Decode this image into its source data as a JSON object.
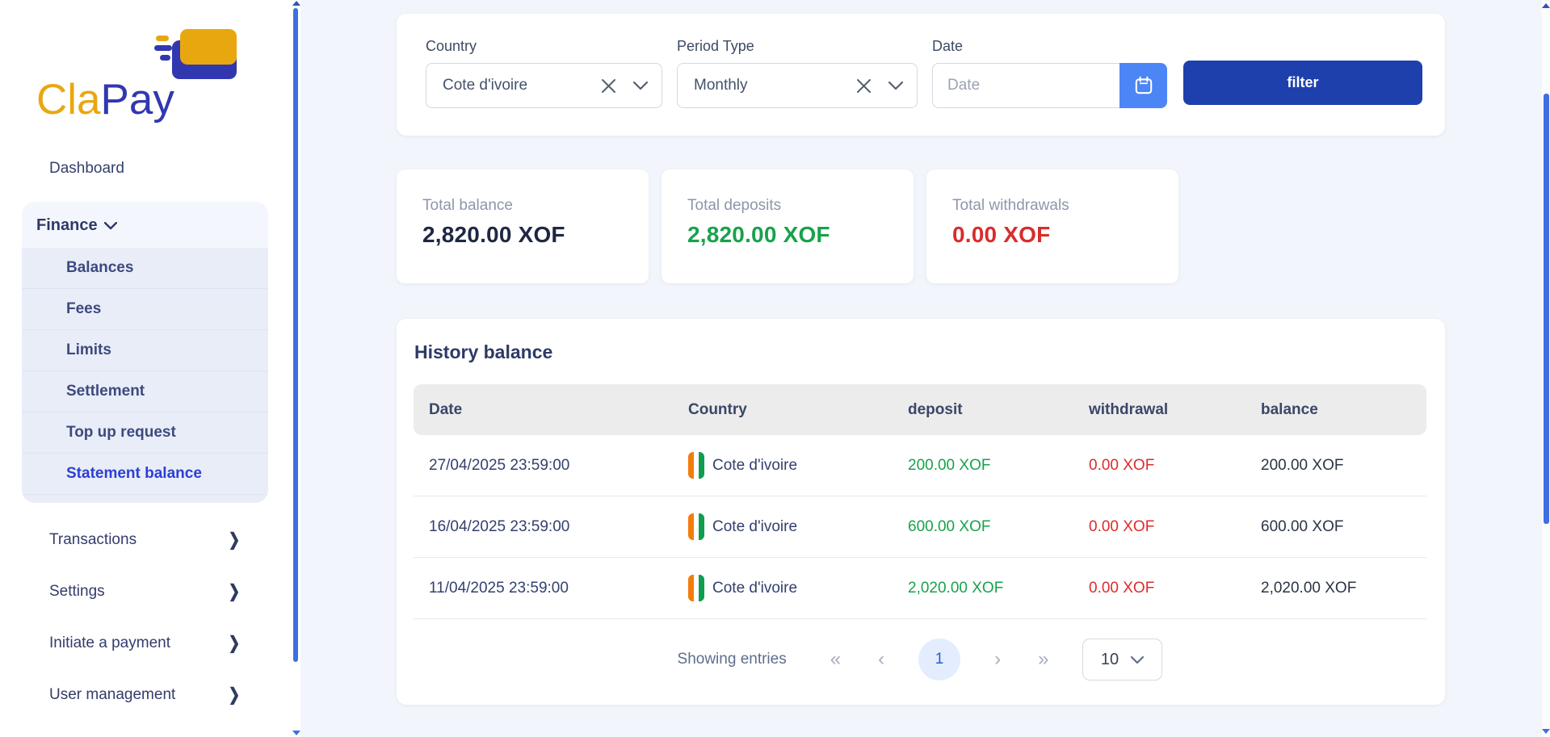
{
  "sidebar": {
    "logo": {
      "part1": "Cla",
      "part2": "Pay"
    },
    "dashboard_label": "Dashboard",
    "finance": {
      "label": "Finance",
      "items": [
        {
          "label": "Balances",
          "active": false
        },
        {
          "label": "Fees",
          "active": false
        },
        {
          "label": "Limits",
          "active": false
        },
        {
          "label": "Settlement",
          "active": false
        },
        {
          "label": "Top up request",
          "active": false
        },
        {
          "label": "Statement balance",
          "active": true
        }
      ]
    },
    "menu_items": [
      {
        "label": "Transactions"
      },
      {
        "label": "Settings"
      },
      {
        "label": "Initiate a payment"
      },
      {
        "label": "User management"
      }
    ]
  },
  "filters": {
    "country": {
      "label": "Country",
      "value": "Cote d'ivoire"
    },
    "period_type": {
      "label": "Period Type",
      "value": "Monthly"
    },
    "date": {
      "label": "Date",
      "placeholder": "Date",
      "value": ""
    },
    "filter_button_label": "filter"
  },
  "stats": [
    {
      "label": "Total balance",
      "value": "2,820.00 XOF",
      "color": "#1e2742"
    },
    {
      "label": "Total deposits",
      "value": "2,820.00 XOF",
      "color": "#17a24b"
    },
    {
      "label": "Total withdrawals",
      "value": "0.00 XOF",
      "color": "#d92c2c"
    }
  ],
  "history": {
    "title": "History balance",
    "columns": [
      "Date",
      "Country",
      "deposit",
      "withdrawal",
      "balance"
    ],
    "rows": [
      {
        "date": "27/04/2025 23:59:00",
        "country": "Cote d'ivoire",
        "deposit": "200.00 XOF",
        "withdrawal": "0.00 XOF",
        "balance": "200.00 XOF"
      },
      {
        "date": "16/04/2025 23:59:00",
        "country": "Cote d'ivoire",
        "deposit": "600.00 XOF",
        "withdrawal": "0.00 XOF",
        "balance": "600.00 XOF"
      },
      {
        "date": "11/04/2025 23:59:00",
        "country": "Cote d'ivoire",
        "deposit": "2,020.00 XOF",
        "withdrawal": "0.00 XOF",
        "balance": "2,020.00 XOF"
      }
    ],
    "pagination": {
      "showing_label": "Showing entries",
      "current_page": "1",
      "page_size": "10",
      "icons": {
        "first": "«",
        "prev": "‹",
        "next": "›",
        "last": "»"
      }
    }
  },
  "colors": {
    "accent_blue": "#2b3fd6",
    "filter_button": "#1d40ad",
    "calendar_button": "#4c85f6",
    "deposit_green": "#17a24b",
    "withdrawal_red": "#dd2b2b",
    "scrollbar_blue": "#3e6fe1",
    "flag_orange": "#f47c0c",
    "flag_green": "#0f9d4f"
  }
}
